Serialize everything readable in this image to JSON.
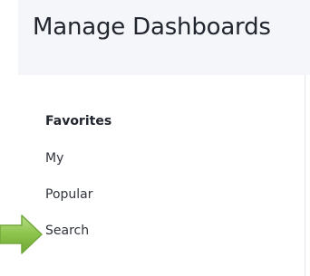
{
  "header": {
    "title": "Manage Dashboards"
  },
  "sidebar": {
    "items": [
      {
        "label": "Favorites",
        "active": true
      },
      {
        "label": "My",
        "active": false
      },
      {
        "label": "Popular",
        "active": false
      },
      {
        "label": "Search",
        "active": false
      }
    ]
  },
  "annotation": {
    "icon": "arrow-right-icon",
    "color": "#8bc34a"
  }
}
